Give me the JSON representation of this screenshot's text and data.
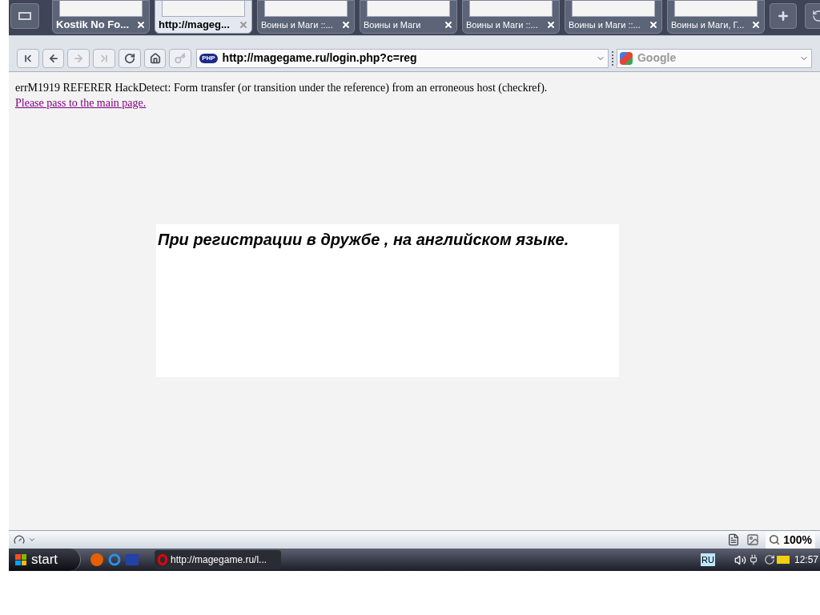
{
  "tabs": [
    {
      "label": "Kostik No Fo...",
      "selected": false
    },
    {
      "label": "http://mageg...",
      "selected": true
    },
    {
      "label": "Воины и Маги ::...",
      "selected": false
    },
    {
      "label": "Воины и Маги",
      "selected": false
    },
    {
      "label": "Воины и Маги ::...",
      "selected": false
    },
    {
      "label": "Воины и Маги ::...",
      "selected": false
    },
    {
      "label": "Воины и Маги, Г...",
      "selected": false
    }
  ],
  "nav_buttons": [
    {
      "kind": "rewind",
      "disabled": false
    },
    {
      "kind": "back",
      "disabled": false
    },
    {
      "kind": "forward",
      "disabled": true
    },
    {
      "kind": "fast-forward",
      "disabled": true
    },
    {
      "kind": "reload",
      "disabled": false
    },
    {
      "kind": "home",
      "disabled": false
    },
    {
      "kind": "key",
      "disabled": true
    }
  ],
  "address": {
    "value": "http://magegame.ru/login.php?c=reg",
    "badge": "PHP"
  },
  "search": {
    "placeholder": "Google"
  },
  "page": {
    "error": "errM1919 REFERER HackDetect: Form transfer (or transition under the reference) from an erroneous host (checkref).",
    "link": "Please pass to the main page.",
    "notice": "При регистрации в дружбе , на английском языке."
  },
  "status_bar": {
    "zoom": "100%"
  },
  "taskbar": {
    "start": "start",
    "task": "http://magegame.ru/l...",
    "language": "RU",
    "clock": "12:57"
  }
}
